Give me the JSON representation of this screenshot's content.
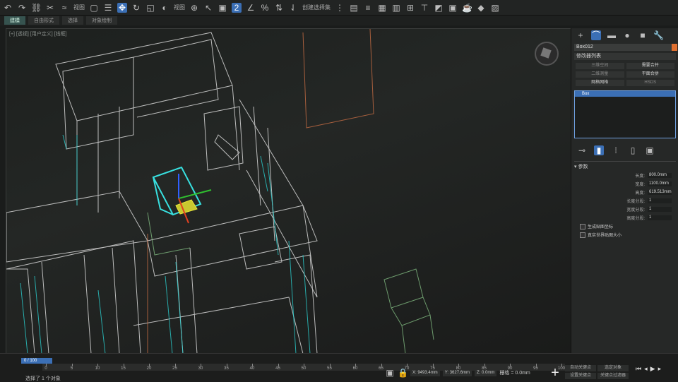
{
  "toolbar": {
    "view_label": "视图",
    "selection_set": "创建选择集"
  },
  "tabs": [
    {
      "label": "建模"
    },
    {
      "label": "自由形式"
    },
    {
      "label": "选择"
    },
    {
      "label": "对象绘制"
    }
  ],
  "viewport": {
    "label": "[+] [透视] [用户定义] [线框]"
  },
  "panel": {
    "object_name": "Box012",
    "dropdown": "修改器列表",
    "buttons": [
      "三维空间",
      "需要合并",
      "二维测量",
      "平面合拼",
      "网格网格",
      "HSDS"
    ],
    "list_item": "Box",
    "rollout_title": "参数",
    "params": [
      {
        "label": "长度:",
        "value": "800.0mm"
      },
      {
        "label": "宽度:",
        "value": "1100.0mm"
      },
      {
        "label": "高度:",
        "value": "619.513mm"
      },
      {
        "label": "长度分段:",
        "value": "1"
      },
      {
        "label": "宽度分段:",
        "value": "1"
      },
      {
        "label": "高度分段:",
        "value": "1"
      }
    ],
    "checks": [
      "生成贴图坐标",
      "真实世界贴图大小"
    ]
  },
  "timeline": {
    "frame": "0 / 100",
    "ticks": [
      "0",
      "5",
      "10",
      "15",
      "20",
      "25",
      "30",
      "35",
      "40",
      "45",
      "50",
      "55",
      "60",
      "65",
      "70",
      "75",
      "80",
      "85",
      "90",
      "95",
      "100"
    ],
    "status": "选择了 1 个对象",
    "coords": [
      "X: 9493.4mm",
      "Y: 3627.6mm",
      "Z: 0.0mm"
    ],
    "grid": "栅格 = 0.0mm",
    "anim_buttons": [
      "自动关键点",
      "选定对象",
      "设置关键点",
      "关键点过滤器"
    ]
  }
}
